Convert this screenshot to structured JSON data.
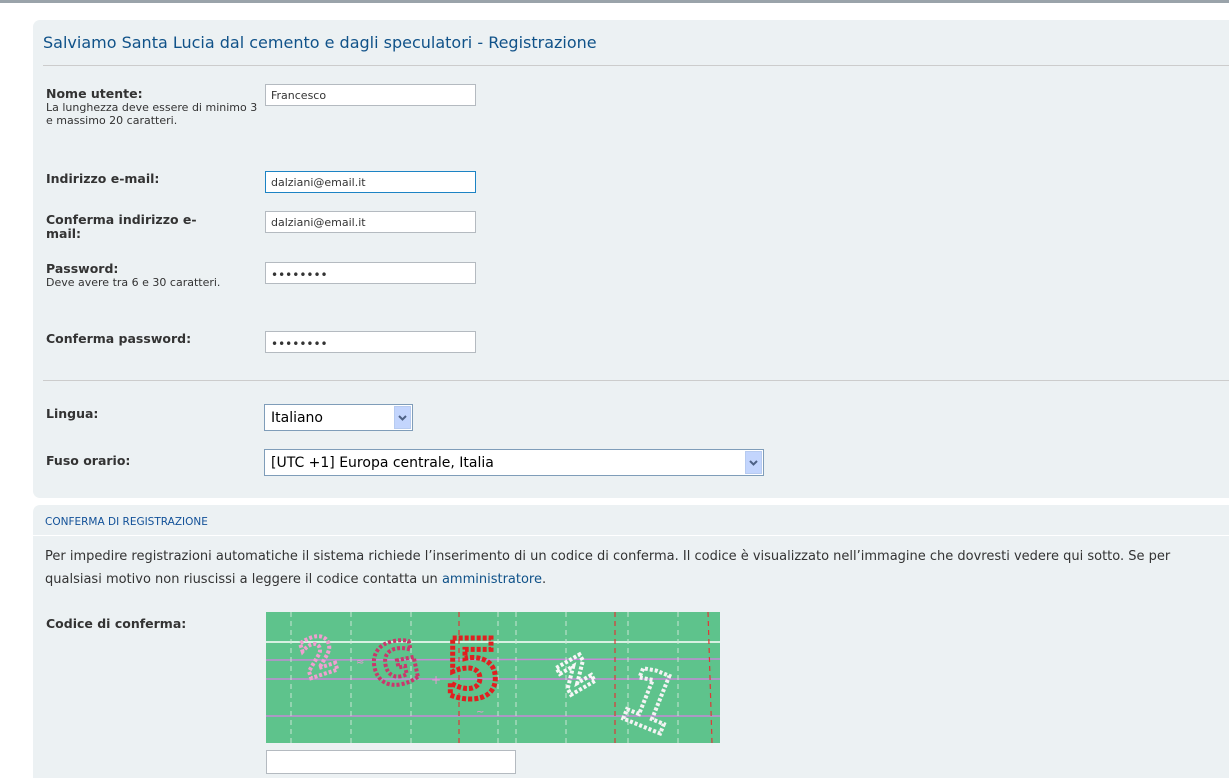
{
  "form": {
    "title": "Salviamo Santa Lucia dal cemento e dagli speculatori - Registrazione",
    "username": {
      "label": "Nome utente:",
      "hint": "La lunghezza deve essere di minimo 3 e massimo 20 caratteri.",
      "value": "Francesco"
    },
    "email": {
      "label": "Indirizzo e-mail:",
      "value": "dalziani@email.it"
    },
    "email_confirm": {
      "label": "Conferma indirizzo e-mail:",
      "value": "dalziani@email.it"
    },
    "password": {
      "label": "Password:",
      "hint": "Deve avere tra 6 e 30 caratteri.",
      "value": "••••••••"
    },
    "password_confirm": {
      "label": "Conferma password:",
      "value": "••••••••"
    },
    "language": {
      "label": "Lingua:",
      "selected": "Italiano"
    },
    "timezone": {
      "label": "Fuso orario:",
      "selected": "[UTC +1] Europa centrale, Italia"
    }
  },
  "confirmation": {
    "heading": "CONFERMA DI REGISTRAZIONE",
    "text": "Per impedire registrazioni automatiche il sistema richiede l’inserimento di un codice di conferma. Il codice è visualizzato nell’immagine che dovresti vedere qui sotto. Se per qualsiasi motivo non riuscissi a leggere il codice contatta un ",
    "link": "amministratore",
    "text_end": ".",
    "code_label": "Codice di conferma:",
    "code_value": "",
    "captcha_text": "2G5Z1"
  },
  "colors": {
    "panel_bg": "#ecf1f3",
    "title": "#105289",
    "focus_border": "#1c83c4",
    "captcha_bg": "#5ec38c"
  },
  "icons": {
    "select_arrow": "chevron-down-icon"
  }
}
